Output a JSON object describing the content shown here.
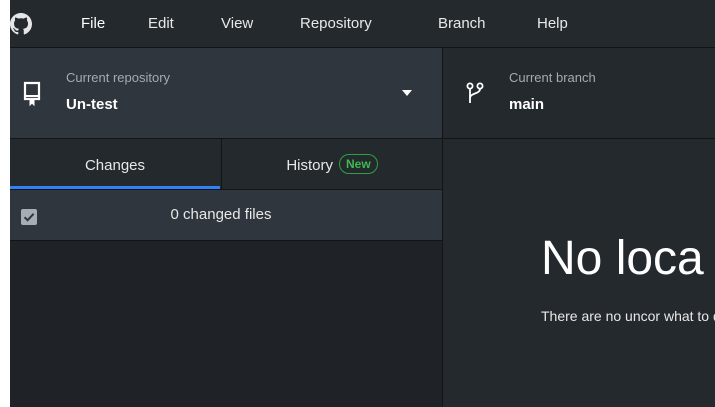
{
  "menu": {
    "items": [
      {
        "label": "File"
      },
      {
        "label": "Edit"
      },
      {
        "label": "View"
      },
      {
        "label": "Repository"
      },
      {
        "label": "Branch"
      },
      {
        "label": "Help"
      }
    ],
    "logo_icon": "github-logo-icon"
  },
  "toolbar": {
    "repository": {
      "label": "Current repository",
      "value": "Un-test",
      "icon": "repo-icon"
    },
    "branch": {
      "label": "Current branch",
      "value": "main",
      "icon": "git-branch-icon"
    }
  },
  "sidebar": {
    "tabs": [
      {
        "label": "Changes",
        "selected": true
      },
      {
        "label": "History",
        "badge": "New"
      }
    ],
    "changed_files_label": "0 changed files",
    "select_all_checked": true
  },
  "main": {
    "title": "No loca",
    "description": "There are no uncor what to do next."
  },
  "colors": {
    "background": "#24292e",
    "panel": "#2f363d",
    "accent": "#2f81f7",
    "badge_green": "#3fb950"
  }
}
